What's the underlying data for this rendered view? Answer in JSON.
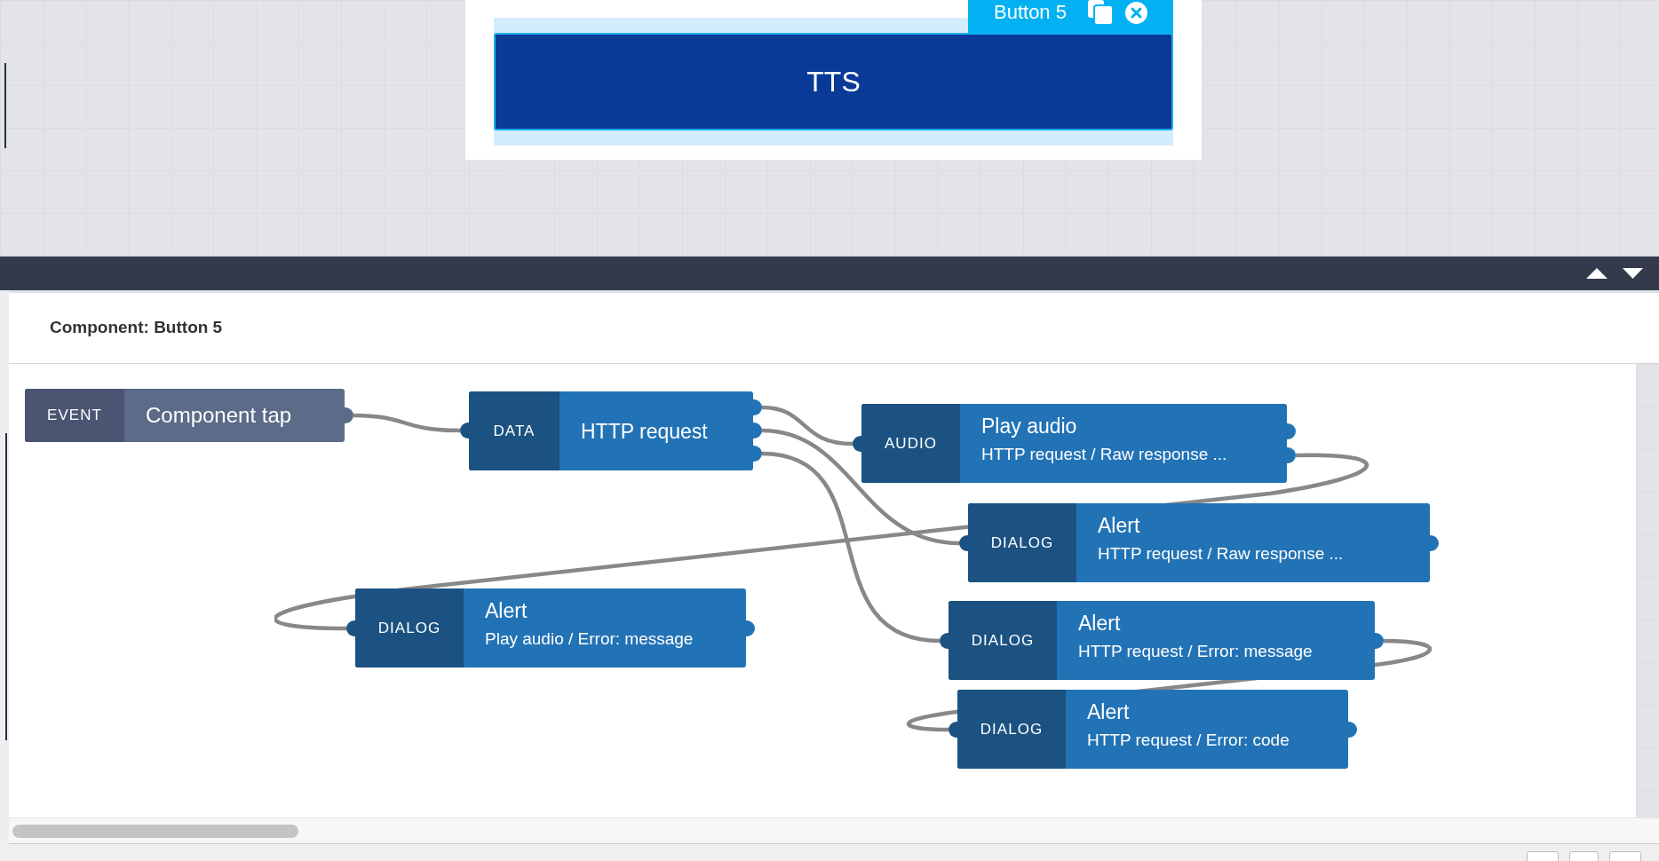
{
  "preview": {
    "selection_tag": {
      "label": "Button 5"
    },
    "button": {
      "label": "TTS"
    }
  },
  "panel": {
    "title": "Component: Button 5",
    "nodes": [
      {
        "kind": "event",
        "tag": "EVENT",
        "title": "Component tap"
      },
      {
        "kind": "action",
        "tag": "DATA",
        "title": "HTTP request"
      },
      {
        "kind": "action",
        "tag": "AUDIO",
        "title": "Play audio",
        "subtitle": "HTTP request / Raw response ..."
      },
      {
        "kind": "action",
        "tag": "DIALOG",
        "title": "Alert",
        "subtitle": "HTTP request / Raw response ..."
      },
      {
        "kind": "action",
        "tag": "DIALOG",
        "title": "Alert",
        "subtitle": "Play audio / Error: message"
      },
      {
        "kind": "action",
        "tag": "DIALOG",
        "title": "Alert",
        "subtitle": "HTTP request / Error: message"
      },
      {
        "kind": "action",
        "tag": "DIALOG",
        "title": "Alert",
        "subtitle": "HTTP request / Error: code"
      }
    ]
  }
}
